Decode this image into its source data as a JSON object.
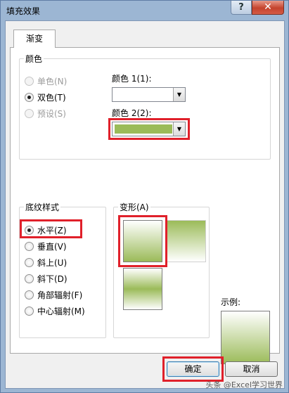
{
  "window": {
    "title": "填充效果",
    "help_label": "?",
    "close_label": "✕"
  },
  "tab": {
    "label": "渐变"
  },
  "colors_group": {
    "legend": "颜色",
    "options": [
      {
        "label": "单色(N)",
        "checked": false,
        "enabled": false
      },
      {
        "label": "双色(T)",
        "checked": true,
        "enabled": true
      },
      {
        "label": "预设(S)",
        "checked": false,
        "enabled": false
      }
    ],
    "color1_label": "颜色 1(1):",
    "color1_value": "#ffffff",
    "color2_label": "颜色 2(2):",
    "color2_value": "#9bbb59"
  },
  "shading_group": {
    "legend": "底纹样式",
    "options": [
      {
        "label": "水平(Z)",
        "checked": true
      },
      {
        "label": "垂直(V)",
        "checked": false
      },
      {
        "label": "斜上(U)",
        "checked": false
      },
      {
        "label": "斜下(D)",
        "checked": false
      },
      {
        "label": "角部辐射(F)",
        "checked": false
      },
      {
        "label": "中心辐射(M)",
        "checked": false
      }
    ]
  },
  "variants_group": {
    "legend": "变形(A)"
  },
  "sample": {
    "label": "示例:"
  },
  "buttons": {
    "ok": "确定",
    "cancel": "取消"
  },
  "watermark": "头条 @Excel学习世界",
  "highlight_color": "#e0202a"
}
